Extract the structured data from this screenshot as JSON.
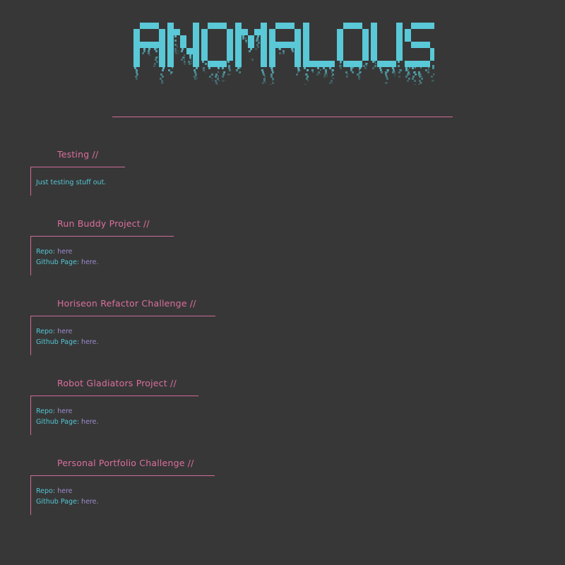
{
  "header": {
    "logo_text": "ANOMALOUS",
    "logo_color": "#5cd0de",
    "accent_color": "#cf6b95"
  },
  "posts": [
    {
      "title": "Testing //",
      "body": "Just testing stuff out."
    },
    {
      "title": "Run Buddy Project //",
      "repo_label": "Repo: ",
      "repo_link": "here",
      "page_label": "Github Page: ",
      "page_link": "here."
    },
    {
      "title": "Horiseon Refactor Challenge //",
      "repo_label": "Repo: ",
      "repo_link": "here",
      "page_label": "Github Page: ",
      "page_link": "here."
    },
    {
      "title": "Robot Gladiators Project //",
      "repo_label": "Repo: ",
      "repo_link": "here",
      "page_label": "Github Page: ",
      "page_link": "here."
    },
    {
      "title": "Personal Portfolio Challenge //",
      "repo_label": "Repo: ",
      "repo_link": "here",
      "page_label": "Github Page: ",
      "page_link": "here."
    }
  ]
}
